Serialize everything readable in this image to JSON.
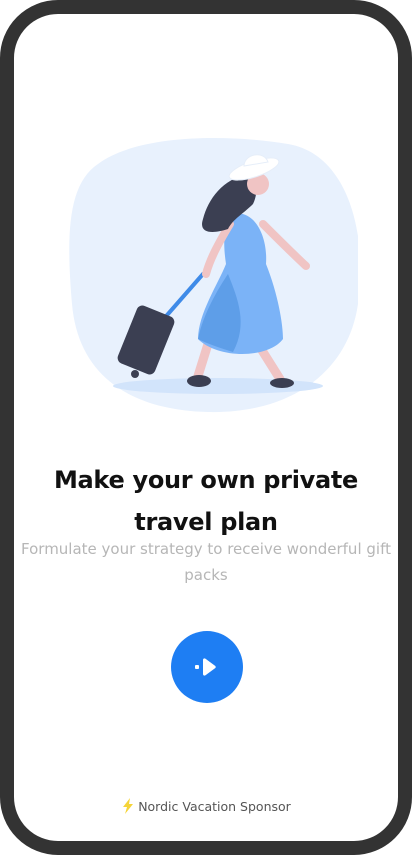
{
  "onboarding": {
    "headline": "Make your own private travel plan",
    "subtitle": "Formulate your strategy to receive wonderful gift packs",
    "next_button_icon": "arrow-right-icon",
    "sponsor_icon": "lightning-bolt-icon",
    "sponsor_text": "Nordic Vacation Sponsor"
  },
  "colors": {
    "accent": "#1e7ef3",
    "frame": "#333333",
    "headline": "#111111",
    "subtitle": "#b6b6b6",
    "illustration_bg": "#e8f1fd",
    "bolt": "#f5d438"
  }
}
